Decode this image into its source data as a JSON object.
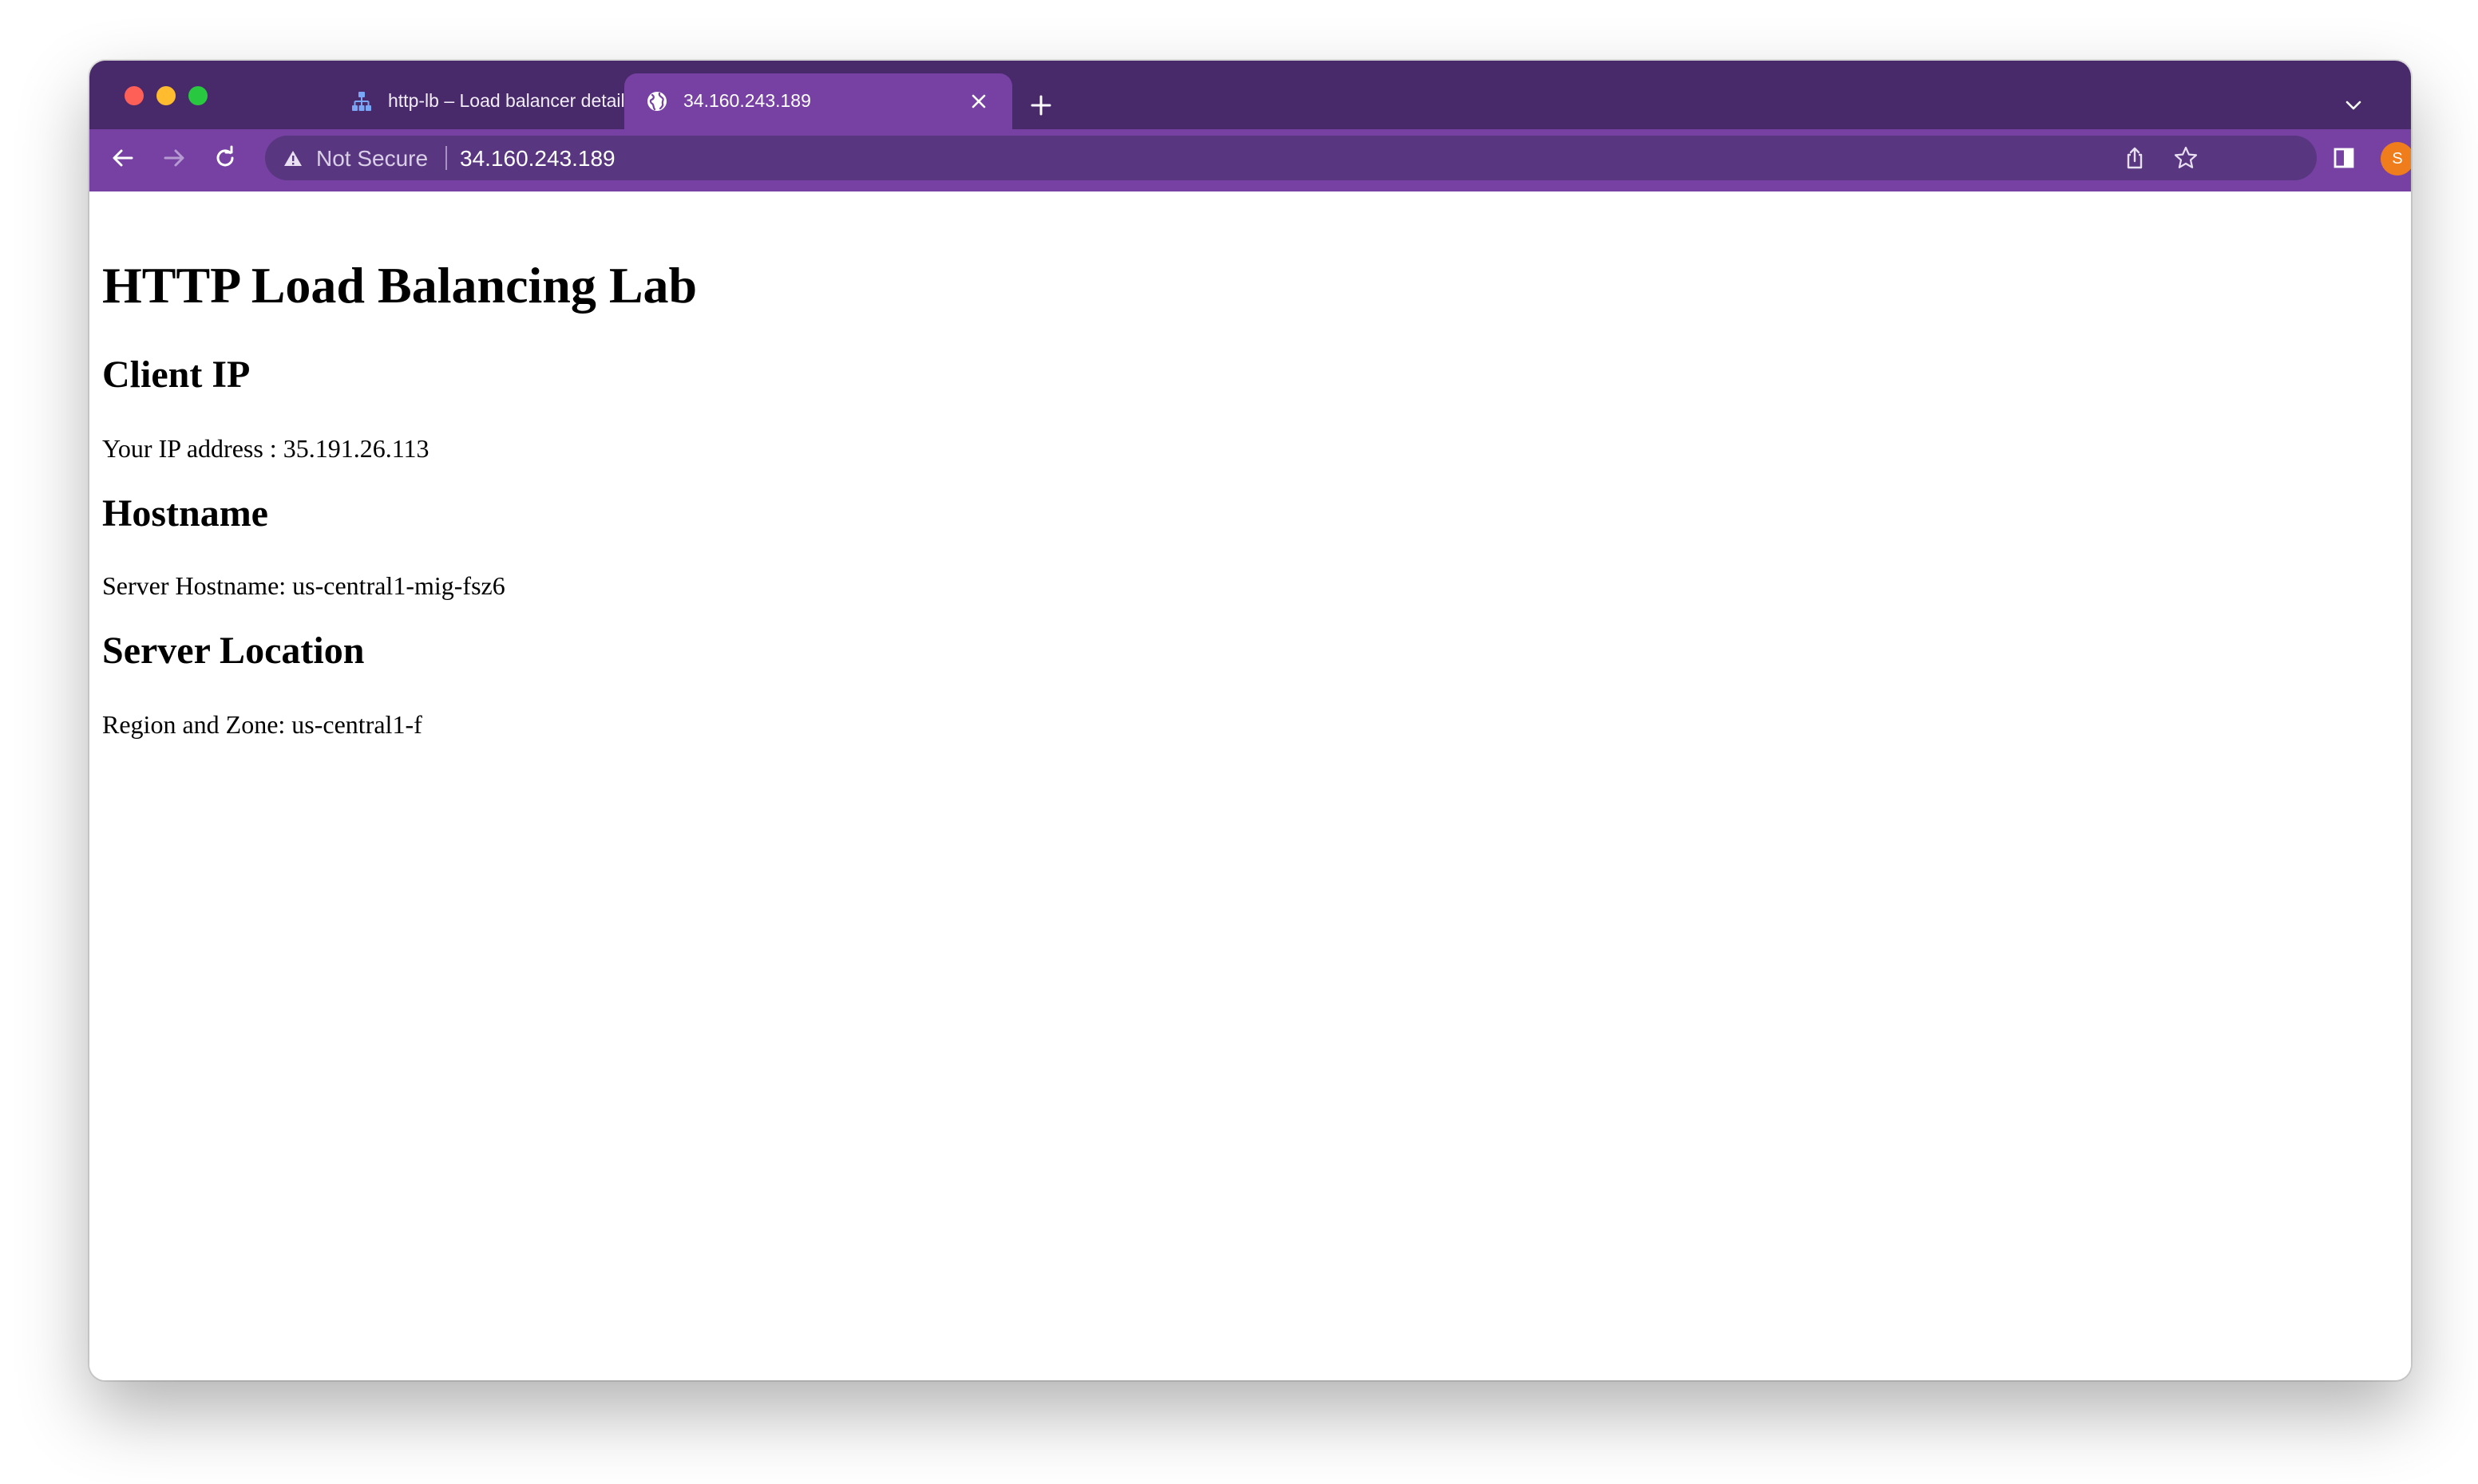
{
  "browser": {
    "tabs": [
      {
        "title": "http-lb – Load balancer details",
        "icon": "load-balancer-icon",
        "active": false
      },
      {
        "title": "34.160.243.189",
        "icon": "globe-icon",
        "active": true
      }
    ],
    "address_bar": {
      "security_label": "Not Secure",
      "url": "34.160.243.189"
    },
    "profile_initial": "S",
    "colors": {
      "tabstrip": "#482a6b",
      "toolbar": "#7641a3",
      "omnibox": "#593680",
      "avatar": "#f07d1b"
    }
  },
  "page": {
    "title": "HTTP Load Balancing Lab",
    "sections": [
      {
        "heading": "Client IP",
        "text": "Your IP address : 35.191.26.113"
      },
      {
        "heading": "Hostname",
        "text": "Server Hostname: us-central1-mig-fsz6"
      },
      {
        "heading": "Server Location",
        "text": "Region and Zone: us-central1-f"
      }
    ]
  }
}
